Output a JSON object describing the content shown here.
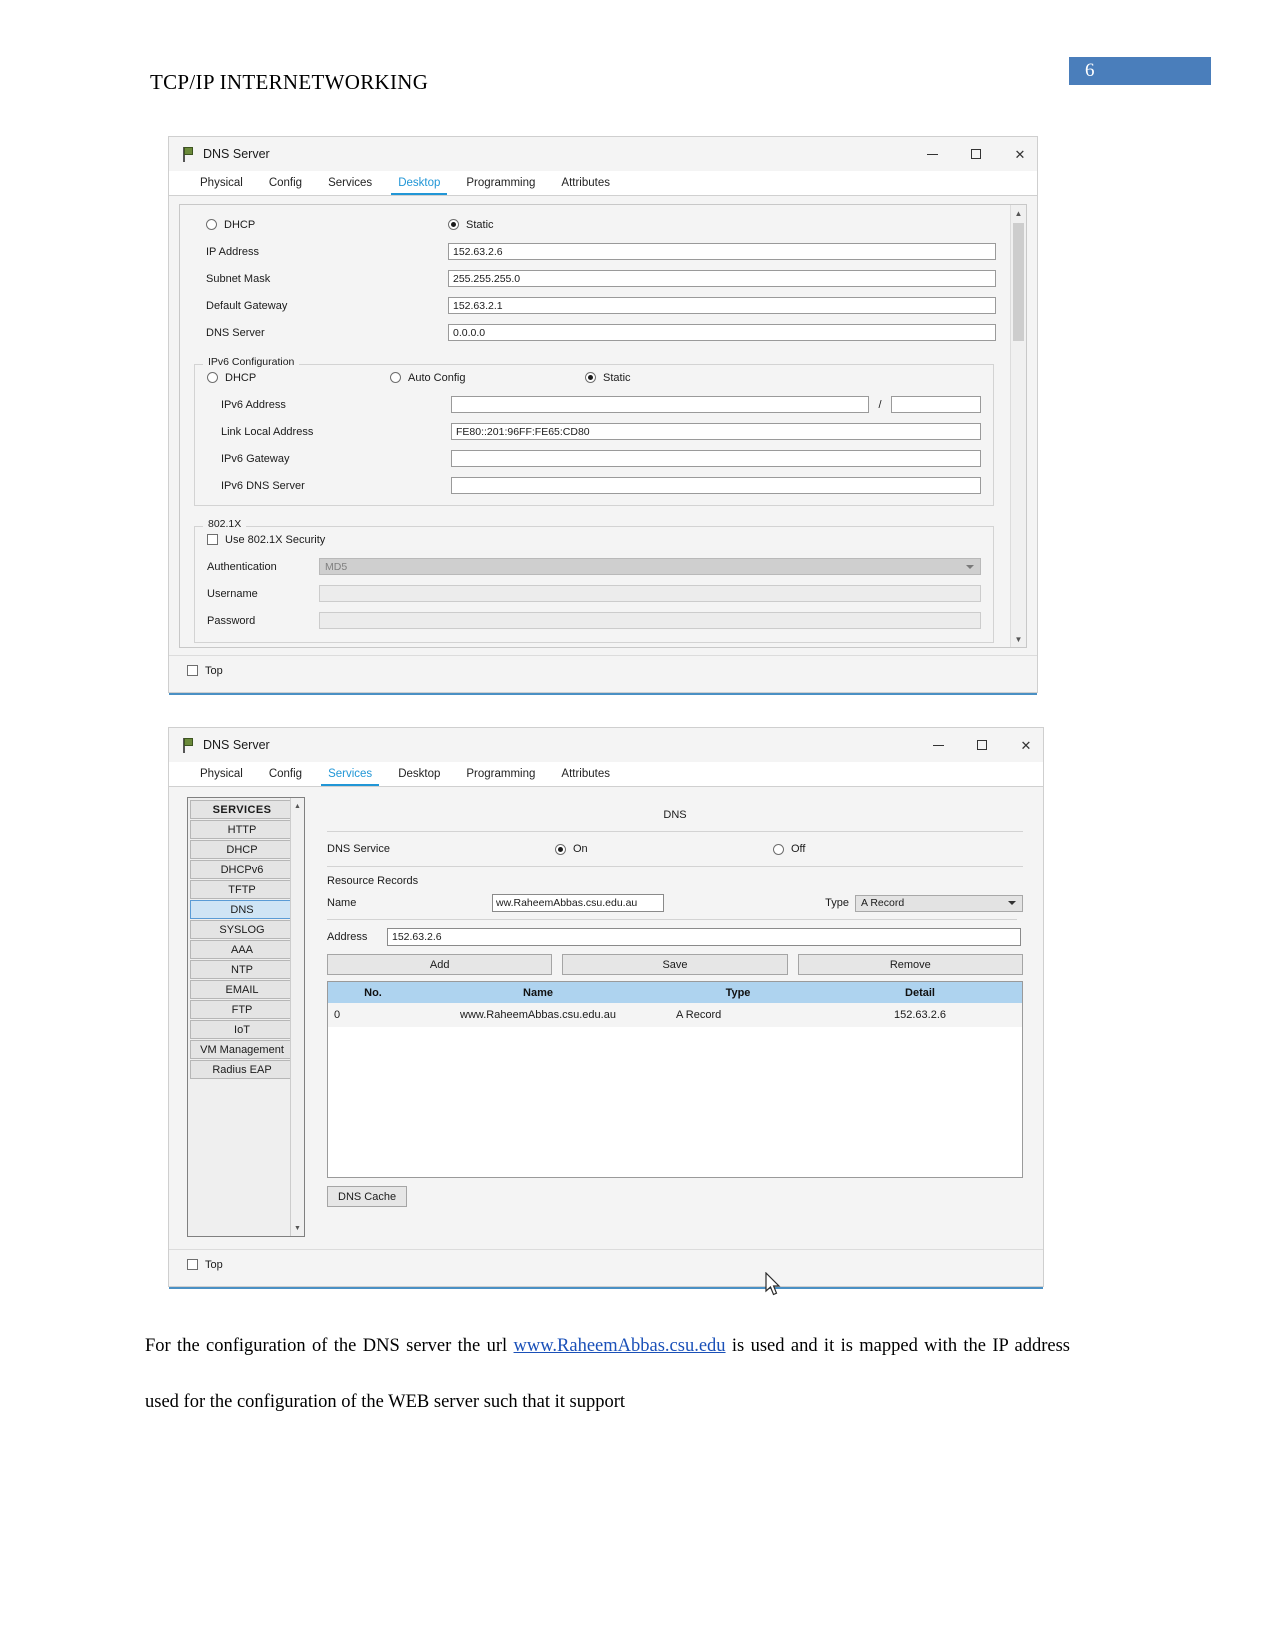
{
  "document": {
    "header_title": "TCP/IP INTERNETWORKING",
    "page_number": "6",
    "page_number_color": "#4a7ebb",
    "paragraph_part1": "For the configuration of the DNS server the url ",
    "paragraph_link": "www.RaheemAbbas.csu.edu",
    "paragraph_part2": " is used and it is mapped with the IP address used for the configuration of the WEB server such that it support",
    "link_color": "#1a50b8"
  },
  "window1": {
    "title": "DNS Server",
    "icon": "packet-tracer-flag-icon",
    "controls": {
      "minimize": "minimize-icon",
      "maximize": "maximize-icon",
      "close": "close-icon"
    },
    "tabs": [
      {
        "label": "Physical",
        "active": false
      },
      {
        "label": "Config",
        "active": false
      },
      {
        "label": "Services",
        "active": false
      },
      {
        "label": "Desktop",
        "active": true
      },
      {
        "label": "Programming",
        "active": false
      },
      {
        "label": "Attributes",
        "active": false
      }
    ],
    "ip_config": {
      "dhcp_label": "DHCP",
      "dhcp_selected": false,
      "static_label": "Static",
      "static_selected": true,
      "fields": [
        {
          "label": "IP Address",
          "value": "152.63.2.6"
        },
        {
          "label": "Subnet Mask",
          "value": "255.255.255.0"
        },
        {
          "label": "Default Gateway",
          "value": "152.63.2.1"
        },
        {
          "label": "DNS Server",
          "value": "0.0.0.0"
        }
      ]
    },
    "ipv6_config": {
      "group_title": "IPv6 Configuration",
      "dhcp_label": "DHCP",
      "dhcp_selected": false,
      "auto_config_label": "Auto Config",
      "auto_config_selected": false,
      "static_label": "Static",
      "static_selected": true,
      "address_label": "IPv6 Address",
      "address_value": "",
      "prefix_separator": "/",
      "prefix_value": "",
      "link_local_label": "Link Local Address",
      "link_local_value": "FE80::201:96FF:FE65:CD80",
      "gateway_label": "IPv6 Gateway",
      "gateway_value": "",
      "dns_label": "IPv6 DNS Server",
      "dns_value": ""
    },
    "dot1x": {
      "group_title": "802.1X",
      "use_security_label": "Use 802.1X Security",
      "use_security_checked": false,
      "auth_label": "Authentication",
      "auth_value": "MD5",
      "username_label": "Username",
      "username_value": "",
      "password_label": "Password",
      "password_value": ""
    },
    "footer": {
      "top_label": "Top",
      "top_checked": false
    }
  },
  "window2": {
    "title": "DNS Server",
    "icon": "packet-tracer-flag-icon",
    "controls": {
      "minimize": "minimize-icon",
      "maximize": "maximize-icon",
      "close": "close-icon"
    },
    "tabs": [
      {
        "label": "Physical",
        "active": false
      },
      {
        "label": "Config",
        "active": false
      },
      {
        "label": "Services",
        "active": true
      },
      {
        "label": "Desktop",
        "active": false
      },
      {
        "label": "Programming",
        "active": false
      },
      {
        "label": "Attributes",
        "active": false
      }
    ],
    "services_list": [
      {
        "label": "SERVICES",
        "header": true,
        "selected": false
      },
      {
        "label": "HTTP",
        "header": false,
        "selected": false
      },
      {
        "label": "DHCP",
        "header": false,
        "selected": false
      },
      {
        "label": "DHCPv6",
        "header": false,
        "selected": false
      },
      {
        "label": "TFTP",
        "header": false,
        "selected": false
      },
      {
        "label": "DNS",
        "header": false,
        "selected": true
      },
      {
        "label": "SYSLOG",
        "header": false,
        "selected": false
      },
      {
        "label": "AAA",
        "header": false,
        "selected": false
      },
      {
        "label": "NTP",
        "header": false,
        "selected": false
      },
      {
        "label": "EMAIL",
        "header": false,
        "selected": false
      },
      {
        "label": "FTP",
        "header": false,
        "selected": false
      },
      {
        "label": "IoT",
        "header": false,
        "selected": false
      },
      {
        "label": "VM Management",
        "header": false,
        "selected": false
      },
      {
        "label": "Radius EAP",
        "header": false,
        "selected": false
      }
    ],
    "dns": {
      "heading": "DNS",
      "service_label": "DNS Service",
      "on_label": "On",
      "on_selected": true,
      "off_label": "Off",
      "off_selected": false,
      "resource_records_label": "Resource Records",
      "name_label": "Name",
      "name_value": "ww.RaheemAbbas.csu.edu.au",
      "type_label": "Type",
      "type_value": "A Record",
      "address_label": "Address",
      "address_value": "152.63.2.6",
      "buttons": {
        "add": "Add",
        "save": "Save",
        "remove": "Remove"
      },
      "table": {
        "columns": [
          "No.",
          "Name",
          "Type",
          "Detail"
        ],
        "rows": [
          {
            "no": "0",
            "name": "www.RaheemAbbas.csu.edu.au",
            "type": "A Record",
            "detail": "152.63.2.6"
          }
        ]
      },
      "cache_button": "DNS Cache"
    },
    "footer": {
      "top_label": "Top",
      "top_checked": false
    }
  }
}
